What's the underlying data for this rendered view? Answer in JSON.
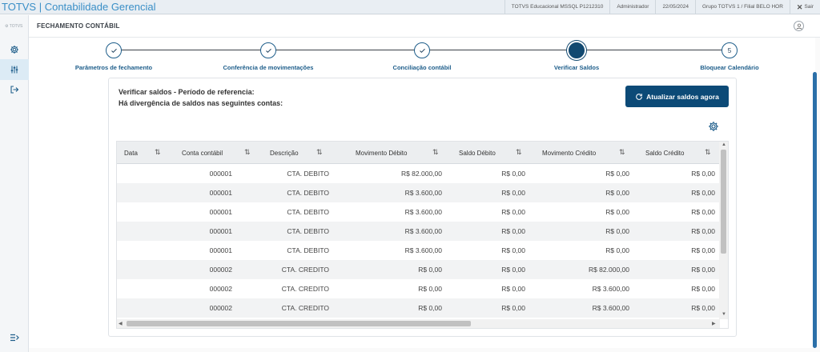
{
  "app": {
    "title": "TOTVS | Contabilidade Gerencial"
  },
  "topbar": {
    "environment": "TOTVS Educacional MSSQL P1212310",
    "user": "Administrador",
    "date": "22/05/2024",
    "branch": "Grupo TOTVS 1 / Filial BELO HOR",
    "exit_label": "Sair"
  },
  "sidebar": {
    "logo_text": "TOTVS",
    "items": [
      "settings",
      "adjustments",
      "logout"
    ]
  },
  "header": {
    "title": "FECHAMENTO CONTÁBIL"
  },
  "stepper": {
    "steps": [
      {
        "label": "Parâmetros de fechamento",
        "state": "done",
        "number": ""
      },
      {
        "label": "Conferência de movimentações",
        "state": "done",
        "number": ""
      },
      {
        "label": "Conciliação contábil",
        "state": "done",
        "number": ""
      },
      {
        "label": "Verificar Saldos",
        "state": "current",
        "number": ""
      },
      {
        "label": "Bloquear Calendário",
        "state": "pending",
        "number": "5"
      }
    ]
  },
  "content": {
    "line1": "Verificar saldos - Período de referencia:",
    "line2": "Há divergência de saldos nas seguintes contas:",
    "refresh_button": "Atualizar saldos agora"
  },
  "table": {
    "columns": [
      "Data",
      "Conta contábil",
      "Descrição",
      "Movimento Débito",
      "Saldo Débito",
      "Movimento Crédito",
      "Saldo Crédito"
    ],
    "rows": [
      [
        "",
        "000001",
        "CTA. DEBITO",
        "R$ 82.000,00",
        "R$ 0,00",
        "R$ 0,00",
        "R$ 0,00"
      ],
      [
        "",
        "000001",
        "CTA. DEBITO",
        "R$ 3.600,00",
        "R$ 0,00",
        "R$ 0,00",
        "R$ 0,00"
      ],
      [
        "",
        "000001",
        "CTA. DEBITO",
        "R$ 3.600,00",
        "R$ 0,00",
        "R$ 0,00",
        "R$ 0,00"
      ],
      [
        "",
        "000001",
        "CTA. DEBITO",
        "R$ 3.600,00",
        "R$ 0,00",
        "R$ 0,00",
        "R$ 0,00"
      ],
      [
        "",
        "000001",
        "CTA. DEBITO",
        "R$ 3.600,00",
        "R$ 0,00",
        "R$ 0,00",
        "R$ 0,00"
      ],
      [
        "",
        "000002",
        "CTA. CREDITO",
        "R$ 0,00",
        "R$ 0,00",
        "R$ 82.000,00",
        "R$ 0,00"
      ],
      [
        "",
        "000002",
        "CTA. CREDITO",
        "R$ 0,00",
        "R$ 0,00",
        "R$ 3.600,00",
        "R$ 0,00"
      ],
      [
        "",
        "000002",
        "CTA. CREDITO",
        "R$ 0,00",
        "R$ 0,00",
        "R$ 3.600,00",
        "R$ 0,00"
      ]
    ]
  },
  "colors": {
    "primary": "#0c4a77",
    "accent": "#3a8fc7",
    "step": "#1d5d8a"
  }
}
